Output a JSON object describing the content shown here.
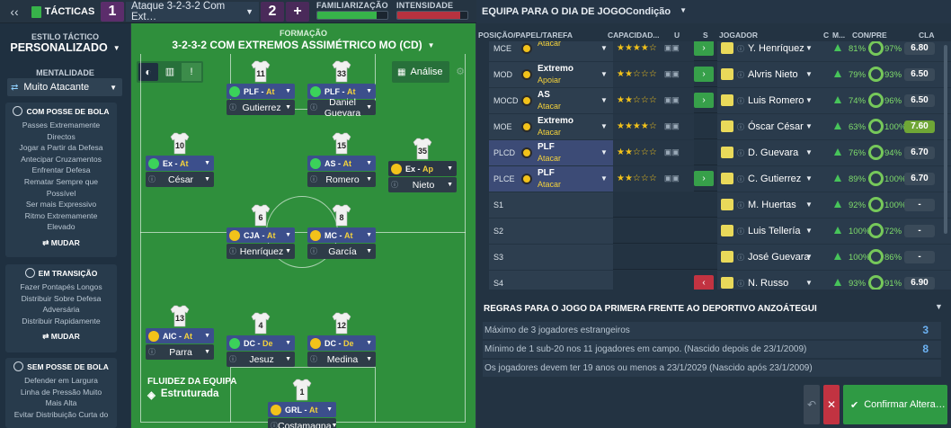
{
  "topbar": {
    "tacticas_label": "TÁCTICAS",
    "tab1_number": "1",
    "tab1_name": "Ataque 3-2-3-2 Com Ext…",
    "tab2_number": "2",
    "add_label": "+",
    "familiarizacao_label": "FAMILIARIZAÇÃO",
    "familiarizacao_level": 0.85,
    "intensidade_label": "INTENSIDADE",
    "intensidade_level": 0.9
  },
  "left": {
    "estilo_label": "ESTILO TÁCTICO",
    "estilo_value": "PERSONALIZADO",
    "mentalidade_label": "MENTALIDADE",
    "mentalidade_value": "Muito Atacante",
    "com_posse": {
      "title": "COM POSSE DE BOLA",
      "items": [
        "Passes Extremamente",
        "Directos",
        "Jogar a Partir da Defesa",
        "Antecipar Cruzamentos",
        "Enfrentar Defesa",
        "Rematar Sempre que",
        "Possível",
        "Ser mais Expressivo",
        "Ritmo Extremamente",
        "Elevado"
      ],
      "button": "MUDAR"
    },
    "transicao": {
      "title": "EM TRANSIÇÃO",
      "items": [
        "Fazer Pontapés Longos",
        "Distribuir Sobre Defesa",
        "Adversária",
        "Distribuir Rapidamente"
      ],
      "button": "MUDAR"
    },
    "sem_posse": {
      "title": "SEM POSSE DE BOLA",
      "items": [
        "Defender em Largura",
        "Linha de Pressão Muito",
        "Mais Alta",
        "Evitar Distribuição Curta do"
      ]
    }
  },
  "pitch": {
    "formacao_label": "FORMAÇÃO",
    "formacao_value": "3-2-3-2 COM EXTREMOS ASSIMÉTRICO MO (CD)",
    "analise_label": "Análise",
    "fluidez_label": "FLUIDEZ DA EQUIPA",
    "fluidez_value": "Estruturada",
    "players": [
      {
        "number": "11",
        "role": "PLF",
        "duty": "At",
        "name": "Gutierrez",
        "dot": "#3bd25a"
      },
      {
        "number": "33",
        "role": "PLF",
        "duty": "At",
        "name": "Daniel Guevara",
        "dot": "#3bd25a"
      },
      {
        "number": "10",
        "role": "Ex",
        "duty": "At",
        "name": "César",
        "dot": "#3bd25a"
      },
      {
        "number": "15",
        "role": "AS",
        "duty": "At",
        "name": "Romero",
        "dot": "#3bd25a"
      },
      {
        "number": "35",
        "role": "Ex",
        "duty": "Ap",
        "name": "Nieto",
        "dot": "#f2c21a"
      },
      {
        "number": "6",
        "role": "CJA",
        "duty": "At",
        "name": "Henríquez",
        "dot": "#f2c21a"
      },
      {
        "number": "8",
        "role": "MC",
        "duty": "At",
        "name": "García",
        "dot": "#f2c21a"
      },
      {
        "number": "13",
        "role": "AIC",
        "duty": "At",
        "name": "Parra",
        "dot": "#f2c21a"
      },
      {
        "number": "4",
        "role": "DC",
        "duty": "De",
        "name": "Jesuz",
        "dot": "#3bd25a"
      },
      {
        "number": "12",
        "role": "DC",
        "duty": "De",
        "name": "Medina",
        "dot": "#f2c21a"
      },
      {
        "number": "1",
        "role": "GRL",
        "duty": "At",
        "name": "Costamagna",
        "dot": "#f2c21a"
      }
    ]
  },
  "right": {
    "title": "EQUIPA PARA O DIA DE JOGO",
    "condicao_label": "Condição",
    "headers": {
      "pos": "POSIÇÃO/PAPEL/TAREFA",
      "cap": "CAPACIDAD...",
      "u": "U",
      "s": "S",
      "jogador": "JOGADOR",
      "c": "C",
      "m": "M...",
      "conpre": "CON/PRE",
      "cla": "CLA"
    },
    "rows": [
      {
        "pos": "MCE",
        "role": "",
        "duty": "Atacar",
        "player": "Y. Henríquez",
        "stars": "★★★★☆",
        "con": "81%",
        "pre": "97%",
        "rating": "6.80"
      },
      {
        "pos": "MOD",
        "role": "Extremo",
        "duty": "Apoiar",
        "player": "Alvris Nieto",
        "stars": "★★☆☆☆",
        "con": "79%",
        "pre": "93%",
        "rating": "6.50"
      },
      {
        "pos": "MOCD",
        "role": "AS",
        "duty": "Atacar",
        "player": "Luis Romero",
        "stars": "★★☆☆☆",
        "con": "74%",
        "pre": "96%",
        "rating": "6.50"
      },
      {
        "pos": "MOE",
        "role": "Extremo",
        "duty": "Atacar",
        "player": "Óscar César",
        "stars": "★★★★☆",
        "con": "63%",
        "pre": "100%",
        "rating": "7.60"
      },
      {
        "pos": "PLCD",
        "role": "PLF",
        "duty": "Atacar",
        "player": "D. Guevara",
        "stars": "★★☆☆☆",
        "con": "76%",
        "pre": "94%",
        "rating": "6.70"
      },
      {
        "pos": "PLCE",
        "role": "PLF",
        "duty": "Atacar",
        "player": "C. Gutierrez",
        "stars": "★★☆☆☆",
        "con": "89%",
        "pre": "100%",
        "rating": "6.70"
      },
      {
        "pos": "S1",
        "role": "",
        "duty": "",
        "player": "M. Huertas",
        "stars": "",
        "con": "92%",
        "pre": "100%",
        "rating": "-"
      },
      {
        "pos": "S2",
        "role": "",
        "duty": "",
        "player": "Luis Tellería",
        "stars": "",
        "con": "100%",
        "pre": "72%",
        "rating": "-"
      },
      {
        "pos": "S3",
        "role": "",
        "duty": "",
        "player": "José Guevara",
        "stars": "",
        "con": "100%",
        "pre": "86%",
        "rating": "-"
      },
      {
        "pos": "S4",
        "role": "",
        "duty": "",
        "player": "N. Russo",
        "stars": "",
        "con": "93%",
        "pre": "91%",
        "rating": "6.90"
      }
    ],
    "rules_title": "REGRAS PARA O JOGO DA PRIMERA FRENTE AO DEPORTIVO ANZOÁTEGUI",
    "rules": [
      {
        "text": "Máximo de 3 jogadores estrangeiros",
        "num": "3"
      },
      {
        "text": "Mínimo de 1 sub-20 nos 11 jogadores em campo. (Nascido depois de 23/1/2009)",
        "num": "8"
      },
      {
        "text": "Os jogadores devem ter 19 anos ou menos a 23/1/2029 (Nascido após 23/1/2009)",
        "num": ""
      }
    ],
    "confirm_label": "Confirmar Altera…",
    "colors": {
      "accent": "#37b34a",
      "danger": "#c23341",
      "star": "#f2c21a"
    }
  }
}
